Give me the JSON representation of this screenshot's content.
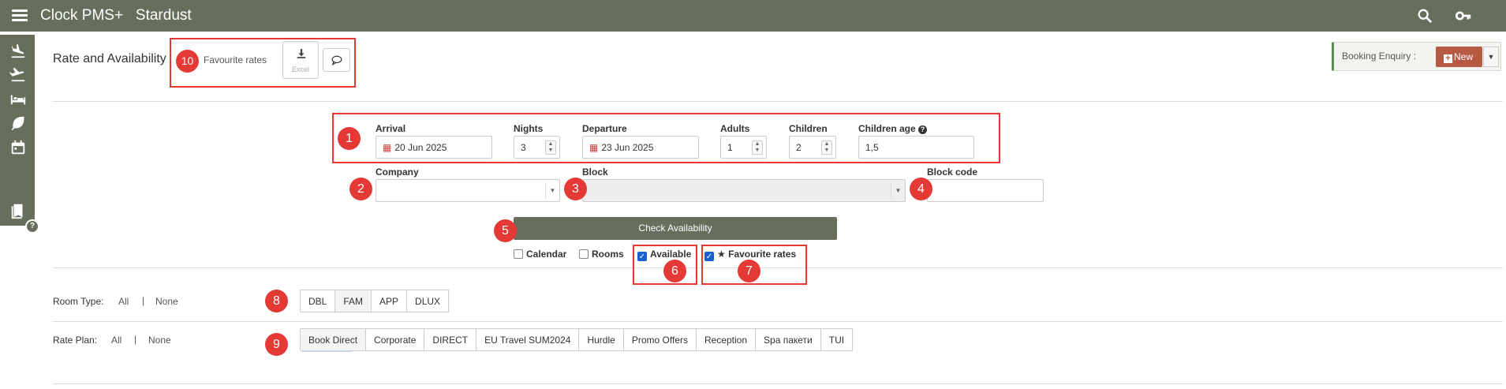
{
  "app": {
    "title": "Clock PMS+",
    "property": "Stardust"
  },
  "icons": {
    "menu": "hamburger-icon",
    "search": "search-icon",
    "key": "key-icon",
    "sidebar": [
      "arrival-plane-icon",
      "departure-plane-icon",
      "bed-icon",
      "leaf-icon",
      "calendar-icon",
      "book-icon"
    ]
  },
  "header": {
    "title": "Rate and Availability",
    "favourite_label": "Favourite rates",
    "excel_label": "Excel",
    "booking_enquiry_label": "Booking Enquiry :",
    "new_label": "New"
  },
  "form": {
    "arrival": {
      "label": "Arrival",
      "value": "20 Jun 2025"
    },
    "nights": {
      "label": "Nights",
      "value": "3"
    },
    "departure": {
      "label": "Departure",
      "value": "23 Jun 2025"
    },
    "adults": {
      "label": "Adults",
      "value": "1"
    },
    "children": {
      "label": "Children",
      "value": "2"
    },
    "children_age": {
      "label": "Children age",
      "value": "1,5"
    },
    "company": {
      "label": "Company",
      "value": ""
    },
    "block": {
      "label": "Block",
      "value": ""
    },
    "block_code": {
      "label": "Block code",
      "value": ""
    },
    "check_button": "Check Availability"
  },
  "options": [
    {
      "label": "Calendar",
      "checked": false
    },
    {
      "label": "Rooms",
      "checked": false
    },
    {
      "label": "Available",
      "checked": true
    },
    {
      "label": "Favourite rates",
      "checked": true,
      "star": "★"
    }
  ],
  "room_type": {
    "label": "Room Type:",
    "all": "All",
    "sep": "|",
    "none": "None",
    "items": [
      "DBL",
      "FAM",
      "APP",
      "DLUX"
    ]
  },
  "rate_plan": {
    "label": "Rate Plan:",
    "all": "All",
    "sep": "|",
    "none": "None",
    "items": [
      "Book Direct",
      "Corporate",
      "DIRECT",
      "EU Travel SUM2024",
      "Hurdle",
      "Promo Offers",
      "Reception",
      "Spa пакети",
      "TUI"
    ]
  },
  "annotations": [
    "1",
    "2",
    "3",
    "4",
    "5",
    "6",
    "7",
    "8",
    "9",
    "10"
  ],
  "colors": {
    "topbar": "#676e5c",
    "annotation": "#e53935",
    "new_button": "#b65a44"
  }
}
